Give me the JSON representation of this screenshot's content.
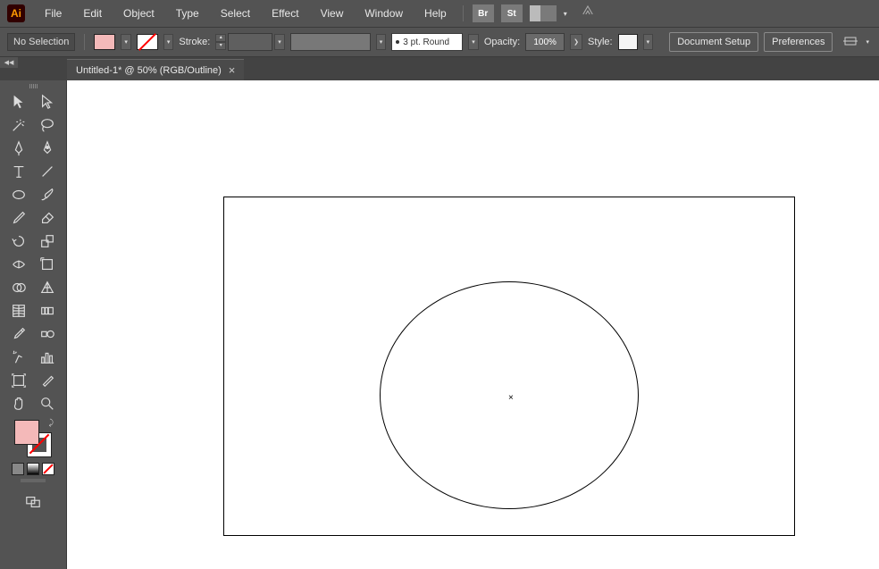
{
  "app": {
    "logo": "Ai"
  },
  "menu": {
    "items": [
      "File",
      "Edit",
      "Object",
      "Type",
      "Select",
      "Effect",
      "View",
      "Window",
      "Help"
    ],
    "bridge": "Br",
    "stock": "St"
  },
  "control": {
    "selection": "No Selection",
    "fill_color": "#f4b9b9",
    "stroke_label": "Stroke:",
    "profile": "3 pt. Round",
    "opacity_label": "Opacity:",
    "opacity_value": "100%",
    "style_label": "Style:",
    "doc_setup": "Document Setup",
    "preferences": "Preferences"
  },
  "tab": {
    "title": "Untitled-1* @ 50% (RGB/Outline)"
  },
  "tools": {
    "left": [
      "selection",
      "magic-wand",
      "pen",
      "type",
      "ellipse",
      "pencil",
      "rotate",
      "width",
      "shape-builder",
      "mesh",
      "eyedropper",
      "symbol-sprayer",
      "artboard",
      "hand"
    ],
    "right": [
      "direct-selection",
      "lasso",
      "curvature",
      "line",
      "paintbrush",
      "eraser",
      "scale",
      "free-transform",
      "perspective-grid",
      "gradient",
      "blend",
      "column-graph",
      "slice",
      "zoom"
    ]
  },
  "color": {
    "fill": "#f4b9b9"
  }
}
